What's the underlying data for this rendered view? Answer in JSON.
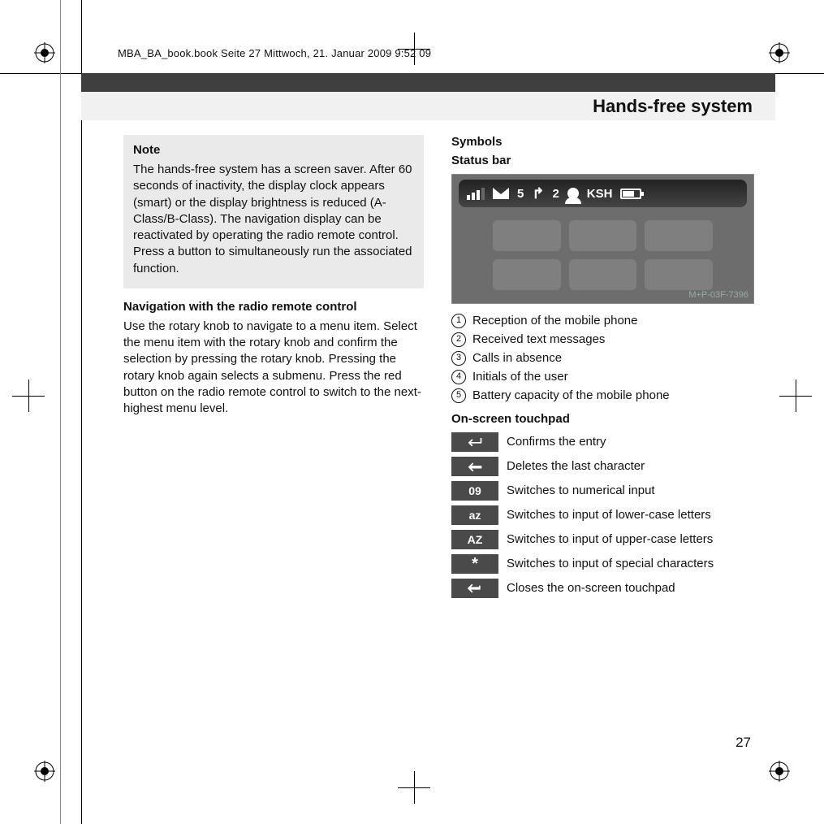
{
  "meta": {
    "framemaker_line": "MBA_BA_book.book  Seite 27  Mittwoch, 21. Januar 2009  9:52 09"
  },
  "header": {
    "title": "Hands-free system"
  },
  "note": {
    "title": "Note",
    "body": "The hands-free system has a screen saver. After 60 seconds of inactivity, the display clock appears (smart) or the display brightness is reduced (A-Class/B-Class). The navigation display can be reactivated by operating the radio remote control. Press a button to simultaneously run the associated function."
  },
  "nav": {
    "heading": "Navigation with the radio remote control",
    "body": "Use the rotary knob to navigate to a menu item. Select the menu item with the rotary knob and confirm the selection by pressing the rotary knob. Pressing the rotary knob again selects a submenu. Press the red button on the radio remote control to switch to the next-highest menu level."
  },
  "symbols": {
    "heading": "Symbols",
    "status_heading": "Status bar",
    "image_code": "M+P-03F-7396",
    "status_values": {
      "messages": "5",
      "missed": "2",
      "initials": "KSH"
    },
    "legend": [
      {
        "n": "1",
        "text": "Reception of the mobile phone"
      },
      {
        "n": "2",
        "text": "Received text messages"
      },
      {
        "n": "3",
        "text": "Calls in absence"
      },
      {
        "n": "4",
        "text": "Initials of the user"
      },
      {
        "n": "5",
        "text": "Battery capacity of the mobile phone"
      }
    ],
    "touchpad_heading": "On-screen touchpad",
    "touchpad": [
      {
        "key": "enter",
        "label": "↵",
        "desc": "Confirms the entry"
      },
      {
        "key": "back",
        "label": "←",
        "desc": "Deletes the last character"
      },
      {
        "key": "num",
        "label": "09",
        "desc": "Switches to numerical input"
      },
      {
        "key": "lower",
        "label": "az",
        "desc": "Switches to input of lower-case letters"
      },
      {
        "key": "upper",
        "label": "AZ",
        "desc": "Switches to input of upper-case letters"
      },
      {
        "key": "special",
        "label": "*",
        "desc": "Switches to input of special characters"
      },
      {
        "key": "close",
        "label": "↩",
        "desc": "Closes the on-screen touchpad"
      }
    ]
  },
  "page_number": "27"
}
